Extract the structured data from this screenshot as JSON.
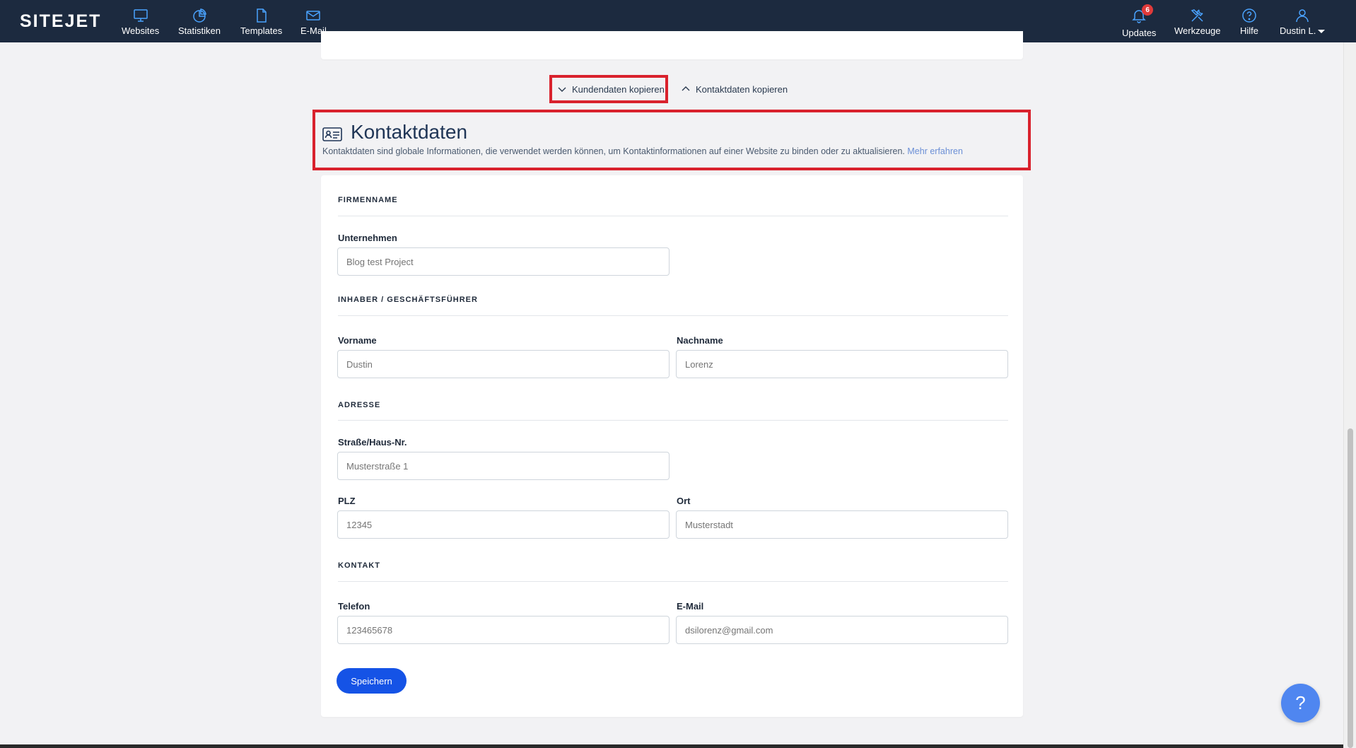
{
  "brand": "SITEJET",
  "nav_left": [
    {
      "label": "Websites",
      "icon": "monitor-icon"
    },
    {
      "label": "Statistiken",
      "icon": "pie-chart-icon"
    },
    {
      "label": "Templates",
      "icon": "file-icon"
    },
    {
      "label": "E-Mail",
      "icon": "mail-icon"
    }
  ],
  "nav_right": [
    {
      "label": "Updates",
      "icon": "bell-icon",
      "badge": "6"
    },
    {
      "label": "Werkzeuge",
      "icon": "tools-icon"
    },
    {
      "label": "Hilfe",
      "icon": "help-circle-icon"
    },
    {
      "label": "Dustin L.",
      "icon": "user-icon"
    }
  ],
  "copy_actions": {
    "customer": "Kundendaten kopieren",
    "contact": "Kontaktdaten kopieren"
  },
  "header": {
    "title": "Kontaktdaten",
    "description": "Kontaktdaten sind globale Informationen, die verwendet werden können, um Kontaktinformationen auf einer Website zu binden oder zu aktualisieren.",
    "link": "Mehr erfahren"
  },
  "form": {
    "company": {
      "section": "FIRMENNAME",
      "label": "Unternehmen",
      "placeholder": "Blog test Project"
    },
    "owner": {
      "section": "INHABER / GESCHÄFTSFÜHRER",
      "first_label": "Vorname",
      "first_placeholder": "Dustin",
      "last_label": "Nachname",
      "last_placeholder": "Lorenz"
    },
    "address": {
      "section": "ADRESSE",
      "street_label": "Straße/Haus-Nr.",
      "street_placeholder": "Musterstraße 1",
      "zip_label": "PLZ",
      "zip_placeholder": "12345",
      "city_label": "Ort",
      "city_placeholder": "Musterstadt"
    },
    "contact": {
      "section": "KONTAKT",
      "phone_label": "Telefon",
      "phone_placeholder": "123465678",
      "email_label": "E-Mail",
      "email_placeholder": "dsilorenz@gmail.com"
    },
    "save_label": "Speichern"
  },
  "help_fab": "?",
  "colors": {
    "navbar": "#1c2a3f",
    "accent": "#1553e6",
    "highlight": "#d9222d",
    "link": "#6b8fd6",
    "fab": "#4f86f0"
  }
}
